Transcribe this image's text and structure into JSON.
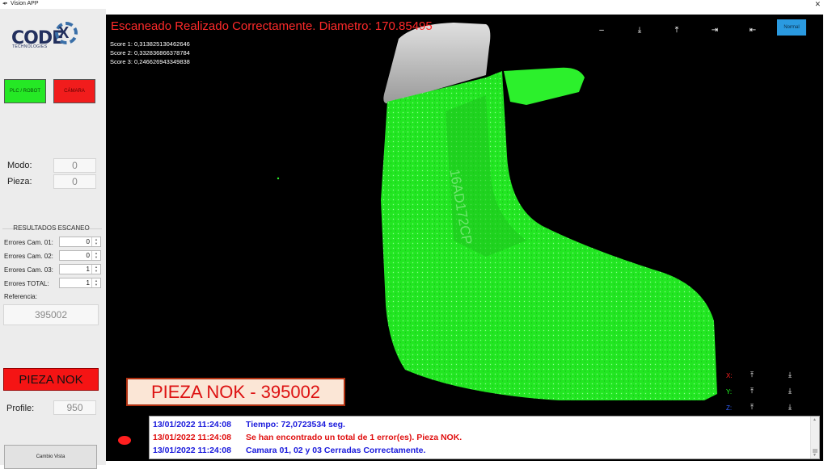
{
  "window": {
    "title": "Vision APP",
    "close_glyph": "✕"
  },
  "left": {
    "logo": {
      "text": "CODE",
      "x_letter": "X",
      "sub": "TECHNOLOGIES"
    },
    "indicators": {
      "plc_label": "PLC / ROBOT",
      "cam_label": "CÁMARA",
      "plc_color": "#25e825",
      "cam_color": "#f11c1c"
    },
    "modo_label": "Modo:",
    "modo_value": "0",
    "pieza_label": "Pieza:",
    "pieza_value": "0",
    "results_title": "RESULTADOS ESCANEO",
    "errors": [
      {
        "label": "Errores Cam. 01:",
        "value": "0"
      },
      {
        "label": "Errores Cam. 02:",
        "value": "0"
      },
      {
        "label": "Errores Cam. 03:",
        "value": "1"
      },
      {
        "label": "Errores TOTAL:",
        "value": "1"
      }
    ],
    "referencia_label": "Referencia:",
    "referencia_value": "395002",
    "status_button": "PIEZA NOK",
    "profile_label": "Profile:",
    "profile_value": "950",
    "cambio_button": "Cambio Vista"
  },
  "viewer": {
    "scan_message": "Escaneado Realizado Correctamente. Diametro: 170.85495",
    "scores": [
      "Score 1: 0,313825130462646",
      "Score 2: 0,332836866378784",
      "Score 3: 0,246626943349838"
    ],
    "view_buttons": [
      "–",
      "⤓",
      "⤒",
      "⇥",
      "⇤"
    ],
    "normal_button": "Normal",
    "axes": [
      {
        "label": "X:",
        "color": "#ff2020"
      },
      {
        "label": "Y:",
        "color": "#20ff20"
      },
      {
        "label": "Z:",
        "color": "#3060ff"
      }
    ],
    "axis_up": "⤒",
    "axis_down": "⤓",
    "part_engraving": "16AD172CP",
    "nok_banner": "PIEZA NOK - 395002",
    "log": [
      {
        "time": "13/01/2022 11:24:08",
        "text": "Tiempo: 72,0723534 seg.",
        "color": "#1a1adc"
      },
      {
        "time": "13/01/2022 11:24:08",
        "text": "Se han encontrado un total de 1 error(es). Pieza NOK.",
        "color": "#e01010"
      },
      {
        "time": "13/01/2022 11:24:08",
        "text": "Camara 01, 02 y 03 Cerradas Correctamente.",
        "color": "#1a1adc"
      }
    ]
  }
}
